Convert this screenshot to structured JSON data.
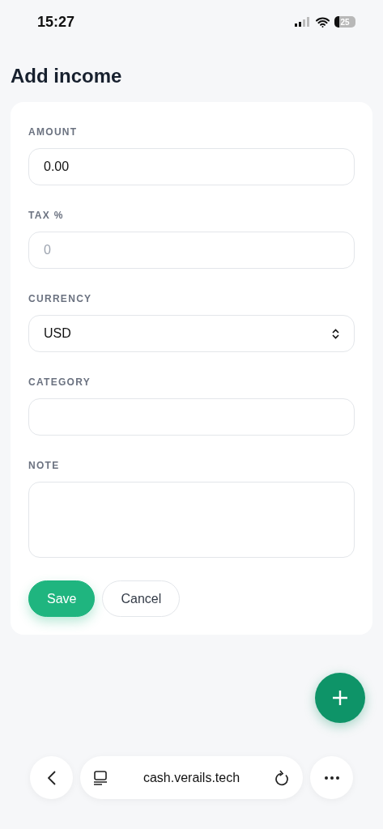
{
  "status_bar": {
    "time": "15:27",
    "battery": "25"
  },
  "title": "Add income",
  "fields": [
    {
      "kind": "input",
      "label": "AMOUNT",
      "value": "0.00"
    },
    {
      "kind": "input",
      "label": "TAX %",
      "placeholder": "0"
    },
    {
      "kind": "select",
      "label": "CURRENCY",
      "value": "USD"
    },
    {
      "kind": "input",
      "label": "CATEGORY"
    },
    {
      "kind": "textarea",
      "label": "NOTE"
    }
  ],
  "buttons": [
    {
      "kind": "primary",
      "label": "Save"
    },
    {
      "kind": "secondary",
      "label": "Cancel"
    }
  ],
  "browser_bar": {
    "url": "cash.verails.tech"
  }
}
